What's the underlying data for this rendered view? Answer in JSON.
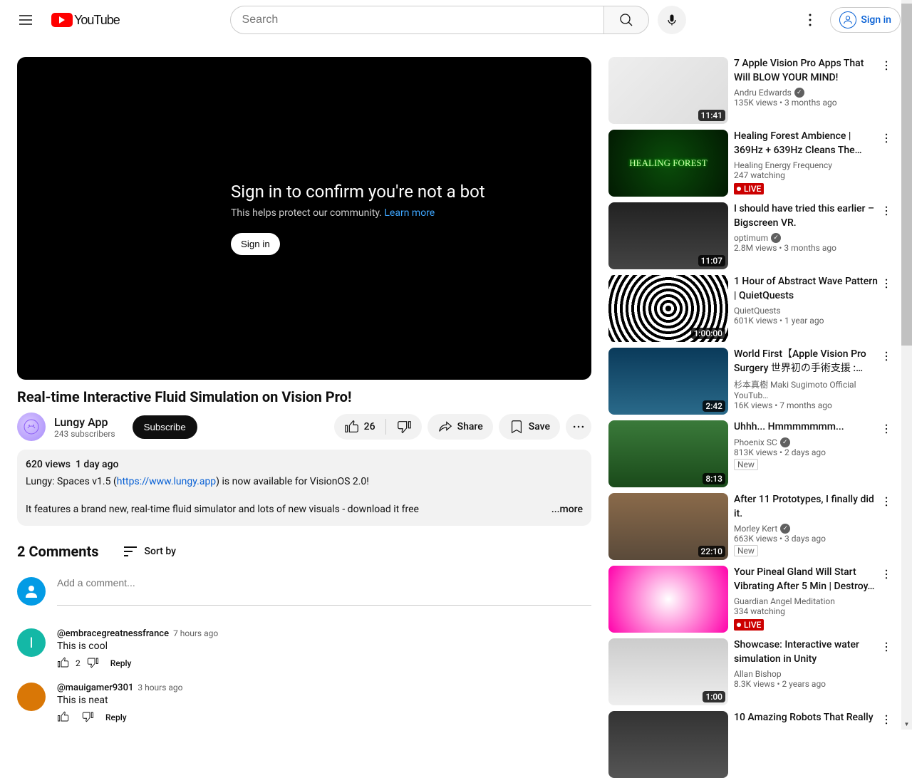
{
  "header": {
    "logo_text": "YouTube",
    "search_placeholder": "Search",
    "signin_label": "Sign in"
  },
  "player": {
    "heading": "Sign in to confirm you're not a bot",
    "subtext": "This helps protect our community. ",
    "learn_more": "Learn more",
    "signin_label": "Sign in"
  },
  "video": {
    "title": "Real-time Interactive Fluid Simulation on Vision Pro!",
    "channel_name": "Lungy App",
    "subscribers": "243 subscribers",
    "subscribe_label": "Subscribe",
    "likes": "26",
    "share_label": "Share",
    "save_label": "Save"
  },
  "description": {
    "views": "620 views",
    "date": "1 day ago",
    "line1_pre": "Lungy: Spaces v1.5 (",
    "line1_link": "https://www.lungy.app",
    "line1_post": ") is now available for VisionOS 2.0!",
    "line2": "It features a brand new, real-time fluid simulator and lots of new visuals - download it free",
    "more": "...more"
  },
  "comments": {
    "count_label": "2 Comments",
    "sort_label": "Sort by",
    "add_placeholder": "Add a comment...",
    "reply_label": "Reply",
    "list": [
      {
        "author": "@embracegreatnessfrance",
        "time": "7 hours ago",
        "text": "This is cool",
        "likes": "2",
        "avatar_bg": "#14b8a6",
        "avatar_letter": "I"
      },
      {
        "author": "@mauigamer9301",
        "time": "3 hours ago",
        "text": "This is neat",
        "likes": "",
        "avatar_bg": "#d97706",
        "avatar_letter": ""
      }
    ]
  },
  "recommendations": [
    {
      "title": "7 Apple Vision Pro Apps That Will BLOW YOUR MIND!",
      "channel": "Andru Edwards",
      "verified": true,
      "meta": "135K views  •  3 months ago",
      "duration": "11:41",
      "thumb_class": "t0"
    },
    {
      "title": "Healing Forest Ambience | 369Hz + 639Hz Cleans The…",
      "channel": "Healing Energy Frequency",
      "verified": false,
      "meta": "247 watching",
      "live": true,
      "thumb_class": "t1",
      "thumb_text": "HEALING FOREST"
    },
    {
      "title": "I should have tried this earlier – Bigscreen VR.",
      "channel": "optimum",
      "verified": true,
      "meta": "2.8M views  •  3 months ago",
      "duration": "11:07",
      "thumb_class": "t2"
    },
    {
      "title": "1 Hour of Abstract Wave Pattern | QuietQuests",
      "channel": "QuietQuests",
      "verified": false,
      "meta": "601K views  •  1 year ago",
      "duration": "1:00:00",
      "thumb_class": "t3"
    },
    {
      "title": "World First【Apple Vision Pro Surgery 世界初の手術支援 : Holoeyes…",
      "channel": "杉本真樹 Maki Sugimoto Official YouTub…",
      "verified": false,
      "meta": "16K views  •  7 months ago",
      "duration": "2:42",
      "thumb_class": "t4"
    },
    {
      "title": "Uhhh... Hmmmmmmm...",
      "channel": "Phoenix SC",
      "verified": true,
      "meta": "813K views  •  2 days ago",
      "duration": "8:13",
      "new": true,
      "thumb_class": "t5"
    },
    {
      "title": "After 11 Prototypes, I finally did it.",
      "channel": "Morley Kert",
      "verified": true,
      "meta": "663K views  •  3 days ago",
      "duration": "22:10",
      "new": true,
      "thumb_class": "t6"
    },
    {
      "title": "Your Pineal Gland Will Start Vibrating After 5 Min | Destroy…",
      "channel": "Guardian Angel Meditation",
      "verified": false,
      "meta": "334 watching",
      "live": true,
      "thumb_class": "t7"
    },
    {
      "title": "Showcase: Interactive water simulation in Unity",
      "channel": "Allan Bishop",
      "verified": false,
      "meta": "8.3K views  •  2 years ago",
      "duration": "1:00",
      "thumb_class": "t8"
    },
    {
      "title": "10 Amazing Robots That Really",
      "channel": "",
      "verified": false,
      "meta": "",
      "thumb_class": "t9"
    }
  ]
}
